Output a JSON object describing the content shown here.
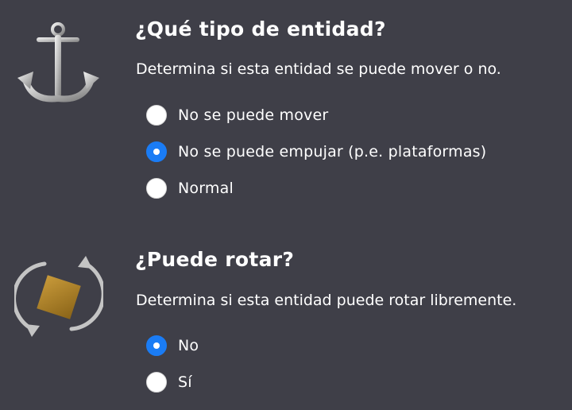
{
  "colors": {
    "background": "#3f3f48",
    "text": "#ffffff",
    "radio_selected": "#1a7cf5"
  },
  "movement": {
    "icon": "anchor-icon",
    "title": "¿Qué tipo de entidad?",
    "description": "Determina si esta entidad se puede mover o no.",
    "options": [
      {
        "label": "No se puede mover",
        "selected": false
      },
      {
        "label": "No se puede empujar (p.e. plataformas)",
        "selected": true
      },
      {
        "label": "Normal",
        "selected": false
      }
    ]
  },
  "rotation": {
    "icon": "rotate-block-icon",
    "title": "¿Puede rotar?",
    "description": "Determina si esta entidad puede rotar libremente.",
    "options": [
      {
        "label": "No",
        "selected": true
      },
      {
        "label": "Sí",
        "selected": false
      }
    ]
  }
}
